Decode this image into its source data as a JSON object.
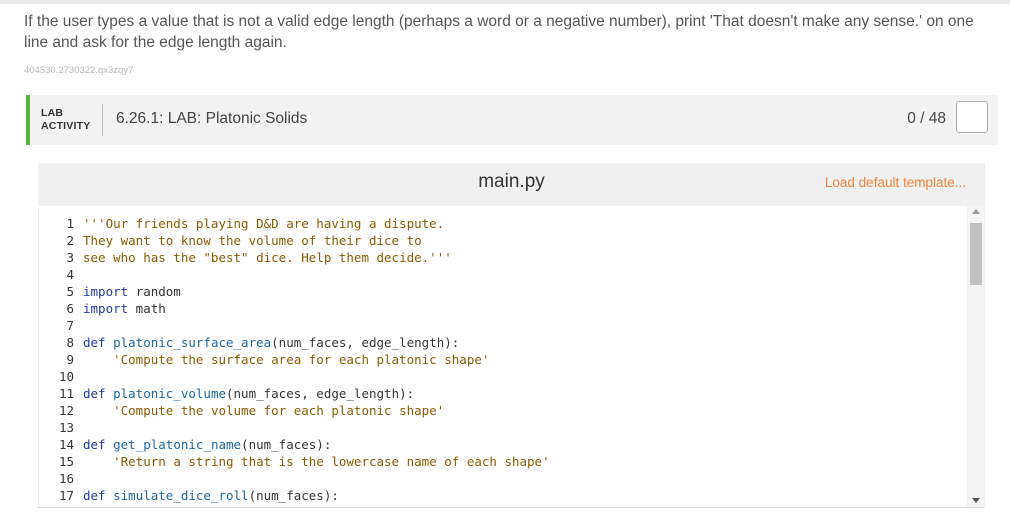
{
  "instructions": "If the user types a value that is not a valid edge length (perhaps a word or a negative number), print 'That doesn't make any sense.' on one line and ask for the edge length again.",
  "hash_id": "404530.2730322.qx3zqy7",
  "lab": {
    "label_line1": "LAB",
    "label_line2": "ACTIVITY",
    "title": "6.26.1: LAB: Platonic Solids",
    "score": "0 / 48"
  },
  "editor": {
    "file_name": "main.py",
    "load_default": "Load default template...",
    "lines": [
      {
        "n": "1",
        "tokens": [
          {
            "t": "'''Our friends playing D&D are having a dispute.",
            "c": "str"
          }
        ]
      },
      {
        "n": "2",
        "tokens": [
          {
            "t": "They want to know the volume of their dice to",
            "c": "str"
          }
        ]
      },
      {
        "n": "3",
        "tokens": [
          {
            "t": "see who has the \"best\" dice. Help them decide.'''",
            "c": "str"
          }
        ]
      },
      {
        "n": "4",
        "tokens": []
      },
      {
        "n": "5",
        "tokens": [
          {
            "t": "import",
            "c": "kw"
          },
          {
            "t": " random",
            "c": "pl"
          }
        ]
      },
      {
        "n": "6",
        "tokens": [
          {
            "t": "import",
            "c": "kw"
          },
          {
            "t": " math",
            "c": "pl"
          }
        ]
      },
      {
        "n": "7",
        "tokens": []
      },
      {
        "n": "8",
        "tokens": [
          {
            "t": "def",
            "c": "kw"
          },
          {
            "t": " ",
            "c": "pl"
          },
          {
            "t": "platonic_surface_area",
            "c": "fn"
          },
          {
            "t": "(num_faces, edge_length):",
            "c": "pl"
          }
        ]
      },
      {
        "n": "9",
        "tokens": [
          {
            "t": "    ",
            "c": "pl"
          },
          {
            "t": "'Compute the surface area for each platonic shape'",
            "c": "str"
          }
        ]
      },
      {
        "n": "10",
        "tokens": []
      },
      {
        "n": "11",
        "tokens": [
          {
            "t": "def",
            "c": "kw"
          },
          {
            "t": " ",
            "c": "pl"
          },
          {
            "t": "platonic_volume",
            "c": "fn"
          },
          {
            "t": "(num_faces, edge_length):",
            "c": "pl"
          }
        ]
      },
      {
        "n": "12",
        "tokens": [
          {
            "t": "    ",
            "c": "pl"
          },
          {
            "t": "'Compute the volume for each platonic shape'",
            "c": "str"
          }
        ]
      },
      {
        "n": "13",
        "tokens": []
      },
      {
        "n": "14",
        "tokens": [
          {
            "t": "def",
            "c": "kw"
          },
          {
            "t": " ",
            "c": "pl"
          },
          {
            "t": "get_platonic_name",
            "c": "fn"
          },
          {
            "t": "(num_faces):",
            "c": "pl"
          }
        ]
      },
      {
        "n": "15",
        "tokens": [
          {
            "t": "    ",
            "c": "pl"
          },
          {
            "t": "'Return a string that is the lowercase name of each shape'",
            "c": "str"
          }
        ]
      },
      {
        "n": "16",
        "tokens": []
      },
      {
        "n": "17",
        "tokens": [
          {
            "t": "def",
            "c": "kw"
          },
          {
            "t": " ",
            "c": "pl"
          },
          {
            "t": "simulate_dice_roll",
            "c": "fn"
          },
          {
            "t": "(num_faces):",
            "c": "pl"
          }
        ]
      }
    ]
  },
  "colors": {
    "accent_green": "#5bb33a",
    "link_orange": "#f0833a",
    "keyword": "#1f3aa8",
    "function": "#1a66a0",
    "string": "#8a5a00"
  }
}
